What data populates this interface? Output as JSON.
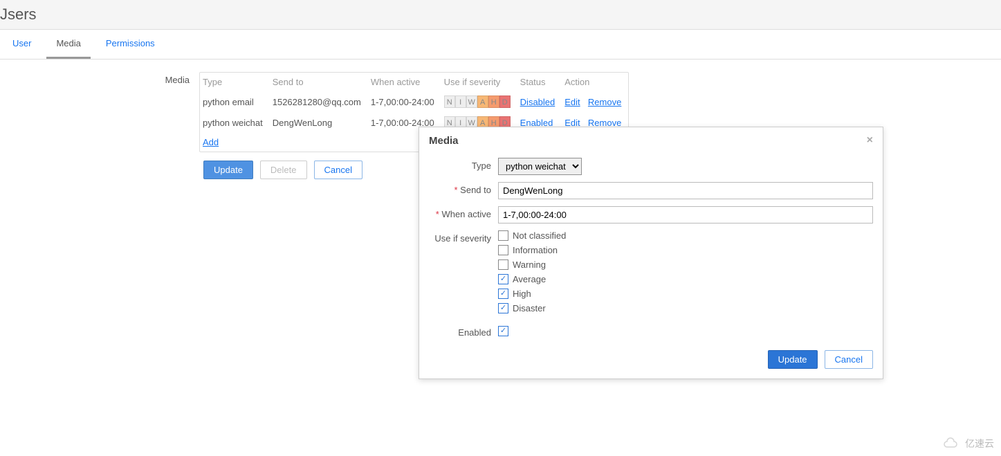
{
  "page": {
    "title": "Jsers"
  },
  "tabs": {
    "user": "User",
    "media": "Media",
    "permissions": "Permissions"
  },
  "mediaSection": {
    "label": "Media",
    "headers": {
      "type": "Type",
      "sendto": "Send to",
      "whenactive": "When active",
      "severity": "Use if severity",
      "status": "Status",
      "action": "Action"
    },
    "rows": [
      {
        "type": "python email",
        "sendto": "1526281280@qq.com",
        "when": "1-7,00:00-24:00",
        "sev": "NIWAHD",
        "status": "Disabled",
        "statusClass": "disabled",
        "edit": "Edit",
        "remove": "Remove"
      },
      {
        "type": "python weichat",
        "sendto": "DengWenLong",
        "when": "1-7,00:00-24:00",
        "sev": "NIWAHD",
        "status": "Enabled",
        "statusClass": "enabled",
        "edit": "Edit",
        "remove": "Remove"
      }
    ],
    "addLink": "Add"
  },
  "buttons": {
    "update": "Update",
    "delete": "Delete",
    "cancel": "Cancel"
  },
  "dialog": {
    "title": "Media",
    "labels": {
      "type": "Type",
      "sendto": "Send to",
      "whenactive": "When active",
      "severity": "Use if severity",
      "enabled": "Enabled"
    },
    "form": {
      "type": "python weichat",
      "sendto": "DengWenLong",
      "whenactive": "1-7,00:00-24:00"
    },
    "severityOptions": [
      {
        "label": "Not classified",
        "checked": false
      },
      {
        "label": "Information",
        "checked": false
      },
      {
        "label": "Warning",
        "checked": false
      },
      {
        "label": "Average",
        "checked": true
      },
      {
        "label": "High",
        "checked": true
      },
      {
        "label": "Disaster",
        "checked": true
      }
    ],
    "enabled": true,
    "buttons": {
      "update": "Update",
      "cancel": "Cancel"
    }
  },
  "watermark": "亿速云"
}
